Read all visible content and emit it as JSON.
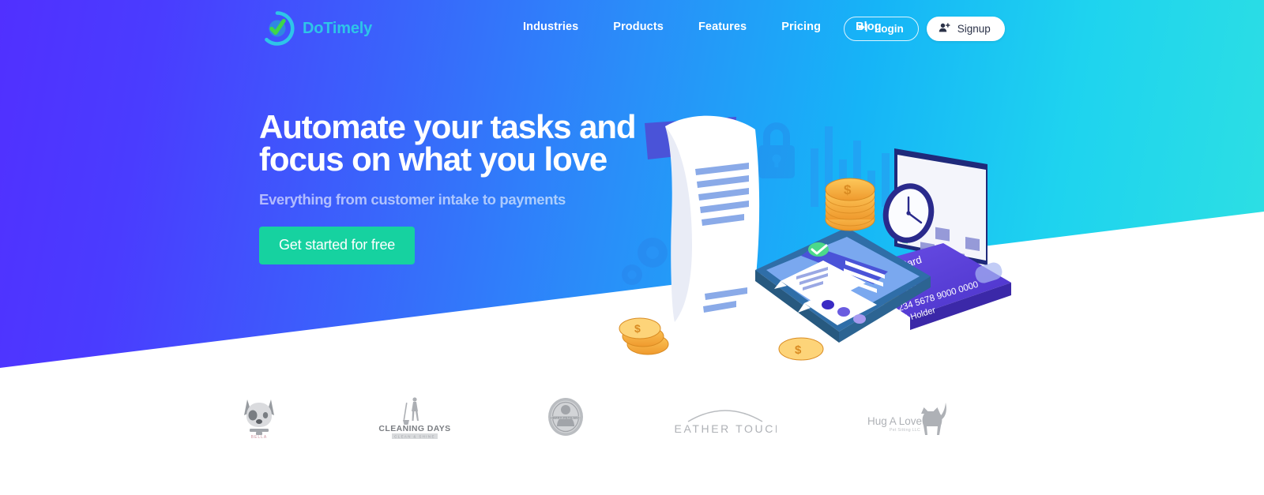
{
  "brand": {
    "name": "DoTimely",
    "logo_icon": "circle-check-logo-icon",
    "brand_color": "#2ec5e8",
    "check_color": "#3fd648"
  },
  "nav": {
    "items": [
      {
        "label": "Industries"
      },
      {
        "label": "Products"
      },
      {
        "label": "Features"
      },
      {
        "label": "Pricing"
      },
      {
        "label": "Blog"
      }
    ]
  },
  "auth": {
    "login_label": "Login",
    "login_icon": "sign-in-icon",
    "signup_label": "Signup",
    "signup_icon": "user-plus-icon"
  },
  "hero": {
    "title_line1": "Automate your tasks and",
    "title_line2": "focus on what you love",
    "subtitle": "Everything from customer intake to payments",
    "cta_label": "Get started for free",
    "cta_color": "#16d2a0",
    "gradient_from": "#5130ff",
    "gradient_to": "#2ee0e2"
  },
  "illustration": {
    "name": "payments-automation-isometric-illustration",
    "elements": [
      "receipt-paper",
      "padlock",
      "gears",
      "bar-chart",
      "coin-stack",
      "clock",
      "calendar",
      "smartphone-chat",
      "credit-card",
      "coins"
    ],
    "card": {
      "title": "Credit Card",
      "number": "1234  5678  9000  0000",
      "holder_label": "Card Holder",
      "chip_icon": "card-chip-icon",
      "contactless_icon": "contactless-icon"
    },
    "coin_symbol": "$"
  },
  "clients": {
    "items": [
      {
        "name": "bella-dog-logo",
        "label": "BELLA",
        "icon": "dog-head-icon"
      },
      {
        "name": "cleaning-days-logo",
        "label": "CLEANING DAYS",
        "tagline": "CLEAN & SHINE",
        "icon": "mop-person-icon"
      },
      {
        "name": "happy-pets-badge-logo",
        "label": "HAPPY PETS NYC",
        "icon": "circular-badge-icon"
      },
      {
        "name": "feather-touch-logo",
        "label": "FEATHER TOUCH",
        "icon": "arc-icon"
      },
      {
        "name": "hug-a-love-logo",
        "label": "Hug A Love",
        "tagline": "Pet Sitting LLC",
        "icon": "cat-silhouette-icon"
      }
    ]
  }
}
